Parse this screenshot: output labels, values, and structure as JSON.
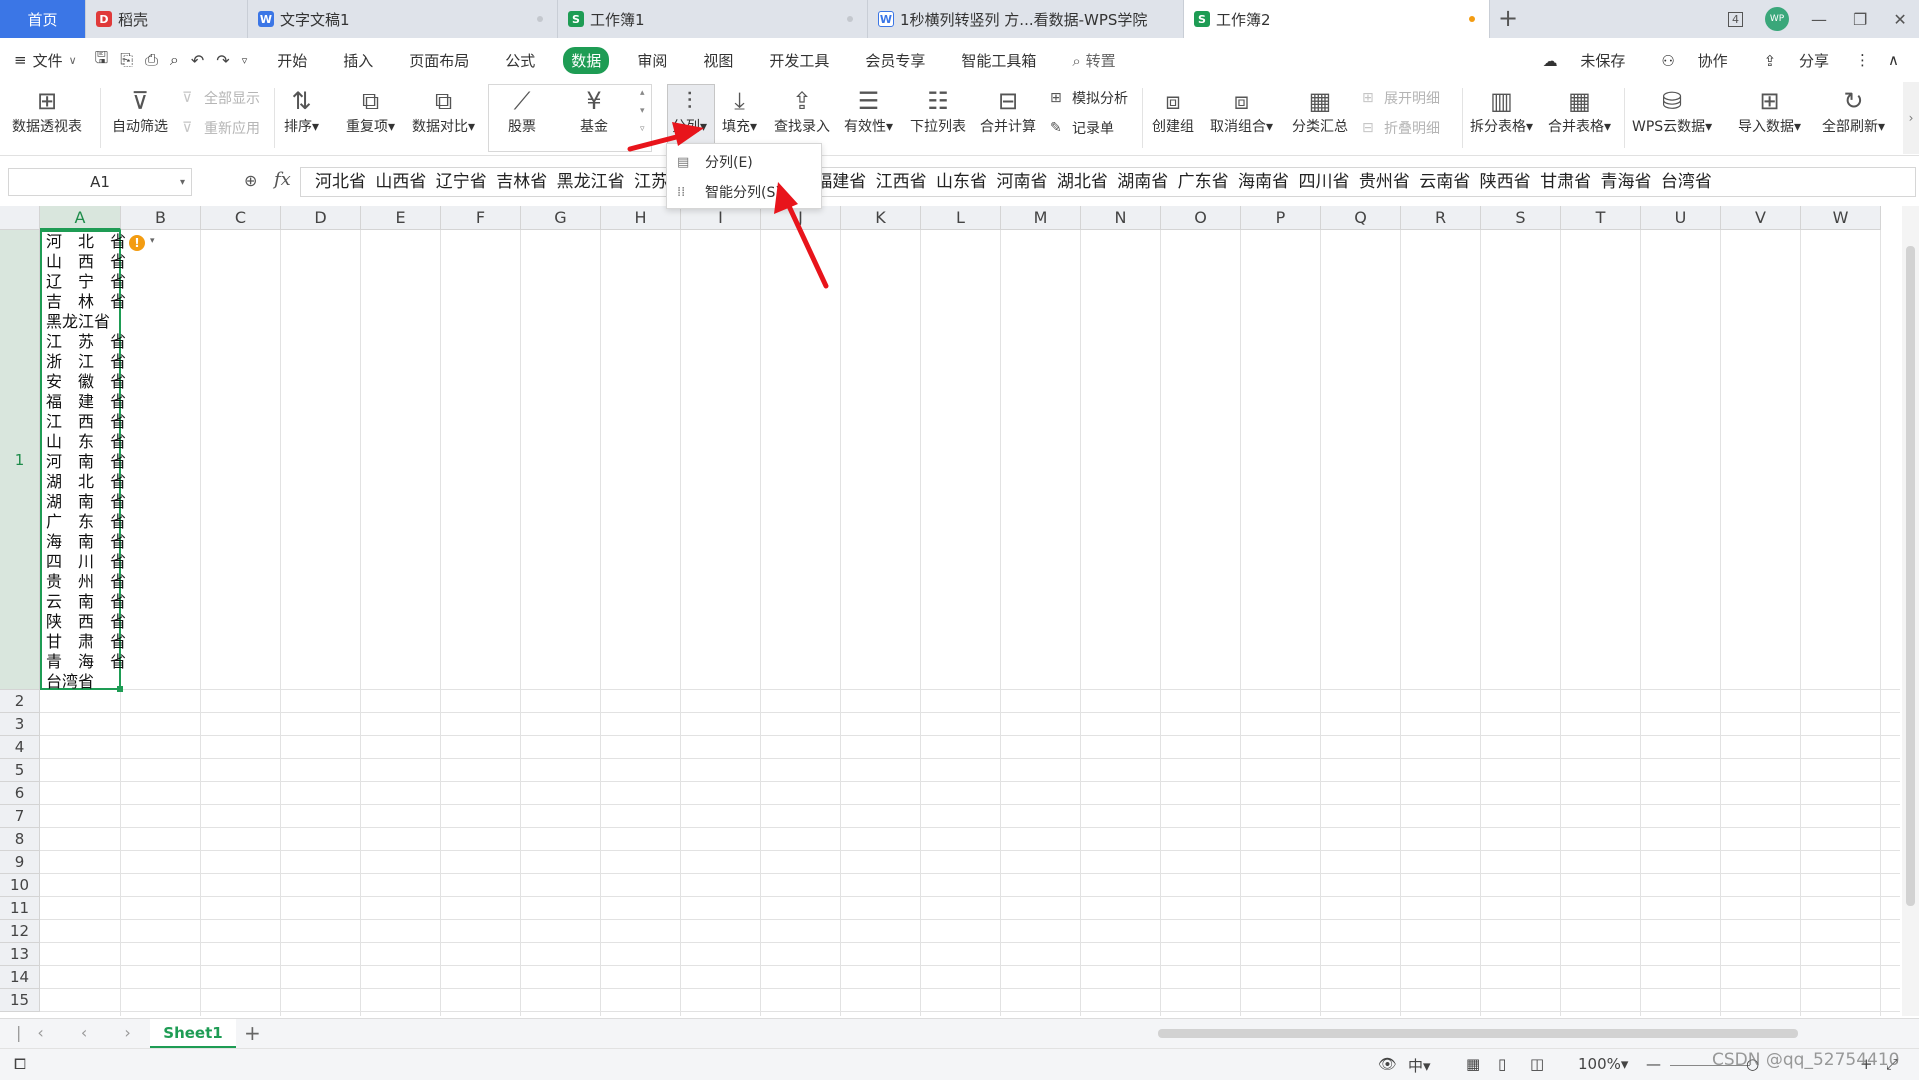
{
  "tabs": [
    {
      "label": "首页",
      "icon": ""
    },
    {
      "label": "稻壳",
      "icon": "docer-icon",
      "color": "#e03a3a",
      "glyph": "D"
    },
    {
      "label": "文字文稿1",
      "icon": "writer-icon",
      "color": "#3b76e6",
      "glyph": "W"
    },
    {
      "label": "工作簿1",
      "icon": "spreadsheet-icon",
      "color": "#1e9c54",
      "glyph": "S"
    },
    {
      "label": "1秒横列转竖列 方...看数据-WPS学院",
      "icon": "wps-academy-icon",
      "color": "#3b76e6",
      "glyph": "W"
    },
    {
      "label": "工作簿2",
      "icon": "spreadsheet-icon",
      "color": "#1e9c54",
      "glyph": "S"
    }
  ],
  "window": {
    "badge": "4",
    "avatar": "WP"
  },
  "menu": {
    "file": "文件",
    "items": [
      "开始",
      "插入",
      "页面布局",
      "公式",
      "数据",
      "审阅",
      "视图",
      "开发工具",
      "会员专享",
      "智能工具箱"
    ],
    "active": "数据",
    "search": "转置",
    "unsaved": "未保存",
    "collab": "协作",
    "share": "分享"
  },
  "ribbon": {
    "pivot": "数据透视表",
    "autofilter": "自动筛选",
    "show_all": "全部显示",
    "reapply": "重新应用",
    "sort": "排序",
    "duplicates": "重复项",
    "compare": "数据对比",
    "stock": "股票",
    "fund": "基金",
    "split": "分列",
    "fill": "填充",
    "lookup": "查找录入",
    "validity": "有效性",
    "dropdown_list": "下拉列表",
    "consolidate": "合并计算",
    "simulate": "模拟分析",
    "record": "记录单",
    "group": "创建组",
    "ungroup": "取消组合",
    "subtotal": "分类汇总",
    "expand": "展开明细",
    "collapse": "折叠明细",
    "split_table": "拆分表格",
    "merge_table": "合并表格",
    "cloud": "WPS云数据",
    "import": "导入数据",
    "refresh": "全部刷新"
  },
  "dropdown": {
    "items": [
      "分列(E)",
      "智能分列(S)"
    ]
  },
  "formula": {
    "namebox": "A1",
    "fx": "fx",
    "content": "河北省 山西省 辽宁省 吉林省 黑龙江省 江苏省 浙江省 安徽省 福建省 江西省 山东省 河南省 湖北省 湖南省 广东省 海南省 四川省 贵州省 云南省 陕西省 甘肃省 青海省 台湾省"
  },
  "columns": [
    "A",
    "B",
    "C",
    "D",
    "E",
    "F",
    "G",
    "H",
    "I",
    "J",
    "K",
    "L",
    "M",
    "N",
    "O",
    "P",
    "Q",
    "R",
    "S",
    "T",
    "U",
    "V",
    "W"
  ],
  "rows": [
    "1",
    "2",
    "3",
    "4",
    "5",
    "6",
    "7",
    "8",
    "9",
    "10",
    "11",
    "12",
    "13",
    "14",
    "15"
  ],
  "cell_a1_lines": [
    "河　北　省",
    "山　西　省",
    "辽　宁　省",
    "吉　林　省",
    "黑龙江省",
    "江　苏　省",
    "浙　江　省",
    "安　徽　省",
    "福　建　省",
    "江　西　省",
    "山　东　省",
    "河　南　省",
    "湖　北　省",
    "湖　南　省",
    "广　东　省",
    "海　南　省",
    "四　川　省",
    "贵　州　省",
    "云　南　省",
    "陕　西　省",
    "甘　肃　省",
    "青　海　省",
    "台湾省"
  ],
  "sheet": {
    "name": "Sheet1"
  },
  "status": {
    "zoom": "100%",
    "input_mode": "中"
  },
  "watermark": "CSDN @qq_52754410",
  "colors": {
    "accent": "#1e9c54",
    "home_tab": "#3b76e6",
    "arrow": "#e8141b"
  }
}
